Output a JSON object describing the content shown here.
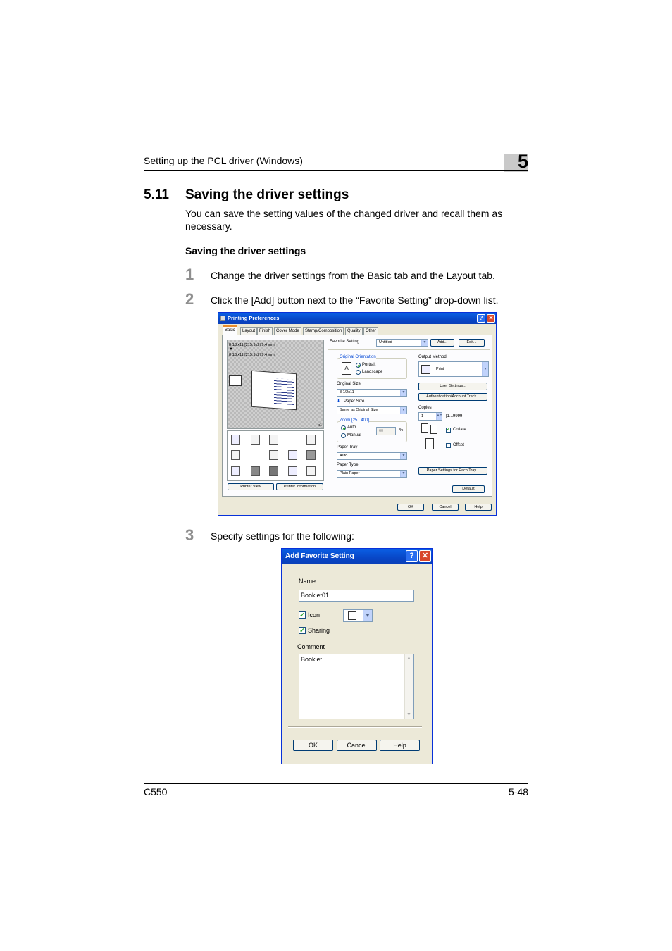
{
  "header": {
    "title": "Setting up the PCL driver (Windows)",
    "chapter": "5"
  },
  "section": {
    "number": "5.11",
    "title": "Saving the driver settings",
    "intro": "You can save the setting values of the changed driver and recall them as necessary.",
    "subheading": "Saving the driver settings"
  },
  "steps": [
    {
      "num": "1",
      "text": "Change the driver settings from the Basic tab and the Layout tab."
    },
    {
      "num": "2",
      "text": "Click the [Add] button next to the “Favorite Setting” drop-down list."
    },
    {
      "num": "3",
      "text": "Specify settings for the following:"
    }
  ],
  "printing_prefs": {
    "title": "Printing Preferences",
    "tabs": [
      "Basic",
      "Layout",
      "Finish",
      "Cover Mode",
      "Stamp/Composition",
      "Quality",
      "Other"
    ],
    "preview_text": [
      "8 1/2x11 [215.9x279.4 mm]",
      "8 1/2x11 [215.9x279.4 mm]"
    ],
    "preview_scale": "x1",
    "favorite_label": "Favorite Setting",
    "favorite_value": "Untitled",
    "add_label": "Add...",
    "edit_label": "Edit...",
    "orientation_group": "Original Orientation",
    "portrait": "Portrait",
    "landscape": "Landscape",
    "original_size_label": "Original Size",
    "original_size_value": "8 1/2x11",
    "paper_size_label": "Paper Size",
    "paper_size_value": "Same as Original Size",
    "zoom_group": "Zoom [25...400]",
    "zoom_auto": "Auto",
    "zoom_manual": "Manual",
    "zoom_value": "60",
    "zoom_unit": "%",
    "paper_tray_label": "Paper Tray",
    "paper_tray_value": "Auto",
    "paper_type_label": "Paper Type",
    "paper_type_value": "Plain Paper",
    "output_method_label": "Output Method",
    "output_method_value": "Print",
    "user_settings": "User Settings...",
    "auth_button": "Authentication/Account Track...",
    "copies_label": "Copies",
    "copies_value": "1",
    "copies_range": "[1...9999]",
    "collate": "Collate",
    "offset": "Offset",
    "paper_settings_each_tray": "Paper Settings for Each Tray...",
    "default_btn": "Default",
    "printer_view": "Printer View",
    "printer_info": "Printer Information",
    "ok": "OK",
    "cancel": "Cancel",
    "help": "Help"
  },
  "add_favorite": {
    "title": "Add Favorite Setting",
    "name_label": "Name",
    "name_value": "Booklet01",
    "icon_label": "Icon",
    "sharing_label": "Sharing",
    "comment_label": "Comment",
    "comment_value": "Booklet",
    "ok": "OK",
    "cancel": "Cancel",
    "help": "Help"
  },
  "footer": {
    "model": "C550",
    "page": "5-48"
  }
}
